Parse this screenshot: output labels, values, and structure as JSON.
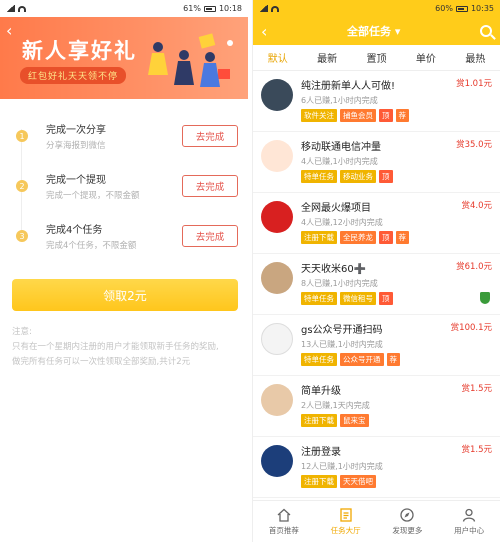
{
  "left": {
    "status": {
      "time": "10:18",
      "battery": "61%"
    },
    "banner": {
      "title": "新人享好礼",
      "subtitle": "红包好礼天天领不停"
    },
    "tasks": [
      {
        "num": "1",
        "title": "完成一次分享",
        "desc": "分享海报到微信",
        "button": "去完成"
      },
      {
        "num": "2",
        "title": "完成一个提现",
        "desc": "完成一个提现，不限金额",
        "button": "去完成"
      },
      {
        "num": "3",
        "title": "完成4个任务",
        "desc": "完成4个任务，不限金额",
        "button": "去完成"
      }
    ],
    "claim_button": "领取2元",
    "note": {
      "line1": "注意:",
      "line2": "只有在一个星期内注册的用户才能领取新手任务的奖励,",
      "line3": "做完所有任务可以一次性领取全部奖励,共计2元"
    }
  },
  "right": {
    "status": {
      "time": "10:35",
      "battery": "60%"
    },
    "nav": {
      "title": "全部任务"
    },
    "tabs": [
      "默认",
      "最新",
      "置顶",
      "单价",
      "最热"
    ],
    "items": [
      {
        "name": "纯注册新单人人可做!",
        "meta": "6人已赚,1小时内完成",
        "price": "赏1.01元",
        "tags": [
          [
            "软件关注",
            "y"
          ],
          [
            "捕鱼会员",
            "o"
          ],
          [
            "顶",
            "r"
          ],
          [
            "荐",
            "o"
          ]
        ]
      },
      {
        "name": "移动联通电信冲量",
        "meta": "4人已赚,1小时内完成",
        "price": "赏35.0元",
        "tags": [
          [
            "特单任务",
            "y"
          ],
          [
            "移动业务",
            "y"
          ],
          [
            "顶",
            "r"
          ]
        ]
      },
      {
        "name": "全网最火爆项目",
        "meta": "4人已赚,12小时内完成",
        "price": "赏4.0元",
        "tags": [
          [
            "注册下载",
            "y"
          ],
          [
            "全民养龙",
            "o"
          ],
          [
            "顶",
            "r"
          ],
          [
            "荐",
            "o"
          ]
        ]
      },
      {
        "name": "天天收米60➕",
        "meta": "8人已赚,1小时内完成",
        "price": "赏61.0元",
        "tags": [
          [
            "特单任务",
            "y"
          ],
          [
            "微信租号",
            "y"
          ],
          [
            "顶",
            "r"
          ]
        ]
      },
      {
        "name": "gs公众号开通扫码",
        "meta": "13人已赚,1小时内完成",
        "price": "赏100.1元",
        "tags": [
          [
            "特单任务",
            "y"
          ],
          [
            "公众号开通",
            "o"
          ],
          [
            "荐",
            "o"
          ]
        ]
      },
      {
        "name": "简单升级",
        "meta": "2人已赚,1天内完成",
        "price": "赏1.5元",
        "tags": [
          [
            "注册下载",
            "y"
          ],
          [
            "鼠来宝",
            "o"
          ]
        ]
      },
      {
        "name": "注册登录",
        "meta": "12人已赚,1小时内完成",
        "price": "赏1.5元",
        "tags": [
          [
            "注册下载",
            "y"
          ],
          [
            "天天借吧",
            "o"
          ]
        ]
      }
    ],
    "tabbar": [
      "首页推荐",
      "任务大厅",
      "发现更多",
      "用户中心"
    ]
  }
}
